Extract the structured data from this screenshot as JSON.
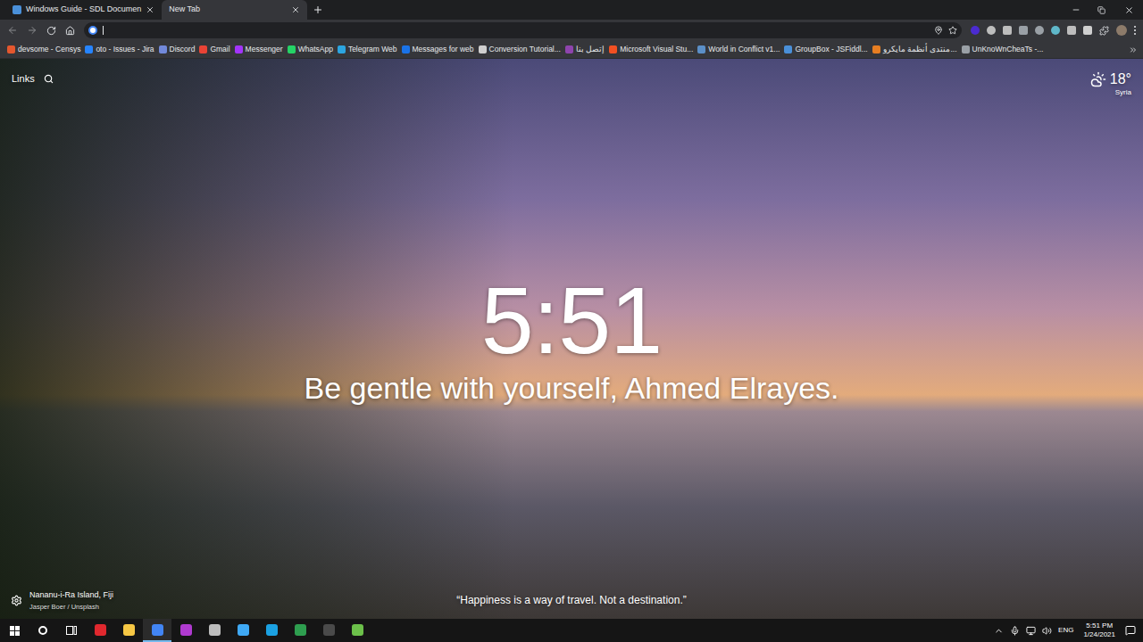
{
  "tabs": [
    {
      "label": "Windows Guide - SDL Documen",
      "selected": false
    },
    {
      "label": "New Tab",
      "selected": true
    }
  ],
  "bookmarks": [
    {
      "label": "devsome - Censys",
      "color": "#e4572e"
    },
    {
      "label": "oto - Issues - Jira",
      "color": "#2684ff"
    },
    {
      "label": "Discord",
      "color": "#7289da"
    },
    {
      "label": "Gmail",
      "color": "#ea4335"
    },
    {
      "label": "Messenger",
      "color": "#a334fa"
    },
    {
      "label": "WhatsApp",
      "color": "#25d366"
    },
    {
      "label": "Telegram Web",
      "color": "#2ca5e0"
    },
    {
      "label": "Messages for web",
      "color": "#1a73e8"
    },
    {
      "label": "Conversion Tutorial...",
      "color": "#cfcfcf"
    },
    {
      "label": "إتصل بنا",
      "color": "#8e44ad"
    },
    {
      "label": "Microsoft Visual Stu...",
      "color": "#f25022"
    },
    {
      "label": "World in Conflict v1...",
      "color": "#5b8fc7"
    },
    {
      "label": "GroupBox - JSFiddl...",
      "color": "#4a90d9"
    },
    {
      "label": "منتدى أنظمة مايكرو...",
      "color": "#e67e22"
    },
    {
      "label": "UnKnoWnCheaTs -...",
      "color": "#9aa0a6"
    }
  ],
  "momentum": {
    "links": "Links",
    "weather": {
      "temp": "18°",
      "location": "Syria"
    },
    "clock": "5:51",
    "greeting": "Be gentle with yourself, Ahmed Elrayes.",
    "photo": {
      "location": "Nananu-i-Ra Island, Fiji",
      "credit": "Jasper Boer / Unsplash"
    },
    "quote": "“Happiness is a way of travel. Not a destination.”"
  },
  "taskbar": {
    "apps": [
      {
        "color": "#e0282e",
        "active": false
      },
      {
        "color": "#f6c744",
        "active": false
      },
      {
        "color": "#4285f4",
        "active": true
      },
      {
        "color": "#b03ad0",
        "active": false
      },
      {
        "color": "#bdbdbd",
        "active": false
      },
      {
        "color": "#3fa9f5",
        "active": false
      },
      {
        "color": "#1ba1e2",
        "active": false
      },
      {
        "color": "#2e9e4f",
        "active": false
      },
      {
        "color": "#4a4a4a",
        "active": false
      },
      {
        "color": "#6cc04a",
        "active": false
      }
    ],
    "language": "ENG",
    "time": "5:51 PM",
    "date": "1/24/2021"
  }
}
